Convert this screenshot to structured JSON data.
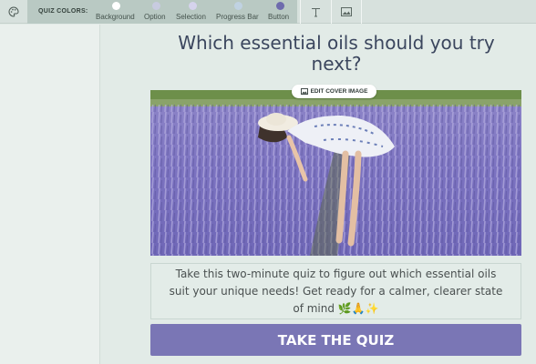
{
  "toolbar": {
    "palette_icon": "palette-icon",
    "colors_label": "QUIZ COLORS:",
    "swatches": [
      {
        "label": "Background",
        "color": "#ffffff"
      },
      {
        "label": "Option",
        "color": "#c8cbe0"
      },
      {
        "label": "Selection",
        "color": "#d5d3ec"
      },
      {
        "label": "Progress Bar",
        "color": "#c0d2e2"
      },
      {
        "label": "Button",
        "color": "#6e6bad"
      }
    ],
    "text_tool_icon": "text-icon",
    "image_tool_icon": "image-icon"
  },
  "quiz": {
    "title": "Which essential oils should you try next?",
    "edit_cover_label": "EDIT COVER IMAGE",
    "description": "Take this two-minute quiz to figure out which essential oils suit your unique needs! Get ready for a calmer, clearer state of mind 🌿🙏✨",
    "cta_label": "TAKE THE QUIZ",
    "accent_color": "#7a76b5"
  }
}
